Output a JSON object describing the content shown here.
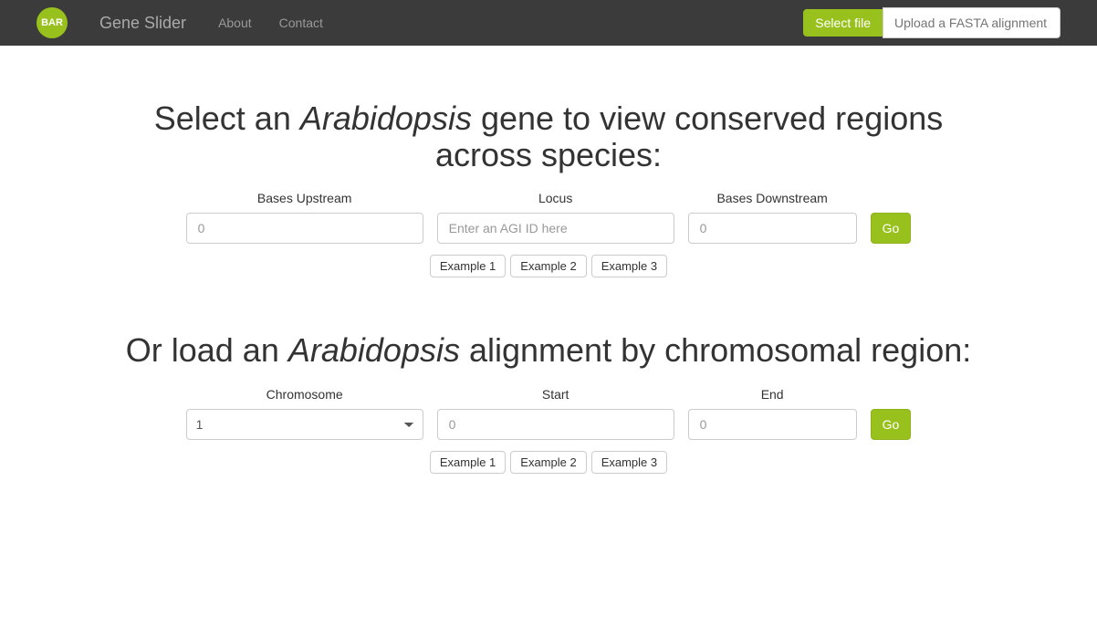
{
  "navbar": {
    "logo_text": "BAR",
    "brand": "Gene Slider",
    "links": [
      {
        "label": "About"
      },
      {
        "label": "Contact"
      }
    ],
    "select_file_label": "Select file",
    "upload_placeholder": "Upload a FASTA alignment"
  },
  "section1": {
    "title_part1": "Select an ",
    "title_italic": "Arabidopsis",
    "title_part2": " gene to view conserved regions across species:",
    "labels": {
      "upstream": "Bases Upstream",
      "locus": "Locus",
      "downstream": "Bases Downstream"
    },
    "placeholders": {
      "upstream": "0",
      "locus": "Enter an AGI ID here",
      "downstream": "0"
    },
    "go_label": "Go",
    "examples": [
      "Example 1",
      "Example 2",
      "Example 3"
    ]
  },
  "section2": {
    "title_part1": "Or load an ",
    "title_italic": "Arabidopsis",
    "title_part2": " alignment by chromosomal region:",
    "labels": {
      "chromosome": "Chromosome",
      "start": "Start",
      "end": "End"
    },
    "chromosome_selected": "1",
    "placeholders": {
      "start": "0",
      "end": "0"
    },
    "go_label": "Go",
    "examples": [
      "Example 1",
      "Example 2",
      "Example 3"
    ]
  }
}
